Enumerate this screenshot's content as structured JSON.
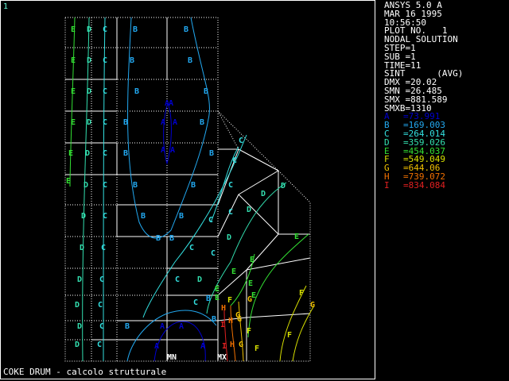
{
  "window_number": "1",
  "caption": "COKE DRUM - calcolo strutturale",
  "info": {
    "header_lines": [
      "ANSYS 5.0 A",
      "MAR 16 1995",
      "10:56:50",
      "PLOT NO.   1",
      "NODAL SOLUTION",
      "STEP=1",
      "SUB =1",
      "TIME=11",
      "SINT      (AVG)",
      "DMX =20.02",
      "SMN =26.485",
      "SMX =881.589",
      "SMXB=1310"
    ],
    "legend": [
      {
        "letter": "A",
        "value": "=73.991",
        "color": "#0000d0"
      },
      {
        "letter": "B",
        "value": "=169.003",
        "color": "#22a8f0"
      },
      {
        "letter": "C",
        "value": "=264.014",
        "color": "#33e0e0"
      },
      {
        "letter": "D",
        "value": "=359.026",
        "color": "#33e0b0"
      },
      {
        "letter": "E",
        "value": "=454.037",
        "color": "#33e033"
      },
      {
        "letter": "F",
        "value": "=549.049",
        "color": "#d8e000"
      },
      {
        "letter": "G",
        "value": "=644.06",
        "color": "#f0c000"
      },
      {
        "letter": "H",
        "value": "=739.072",
        "color": "#f07000"
      },
      {
        "letter": "I",
        "value": "=834.084",
        "color": "#e02020"
      }
    ]
  },
  "plot": {
    "min_marker": "MN",
    "max_marker": "MX"
  }
}
